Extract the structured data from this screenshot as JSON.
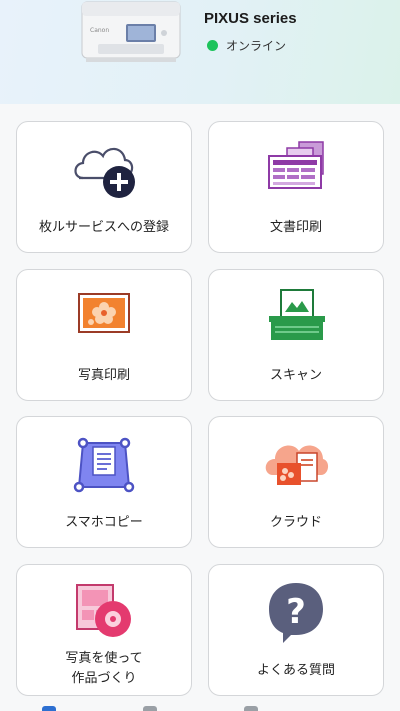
{
  "printer": {
    "name": "PIXUS series",
    "status_text": "オンライン",
    "status_color": "#1cc35b",
    "brand_mark": "Canon"
  },
  "menu": {
    "items": [
      {
        "label": "枚ルサービスへの登録",
        "icon": "cloud-plus-icon"
      },
      {
        "label": "文書印刷",
        "icon": "document-print-icon"
      },
      {
        "label": "写真印刷",
        "icon": "photo-print-icon"
      },
      {
        "label": "スキャン",
        "icon": "scan-icon"
      },
      {
        "label": "スマホコピー",
        "icon": "phone-copy-icon"
      },
      {
        "label": "クラウド",
        "icon": "cloud-icon"
      },
      {
        "label_line1": "写真を使って",
        "label_line2": "作品づくり",
        "icon": "photo-craft-icon"
      },
      {
        "label": "よくある質問",
        "icon": "question-icon"
      }
    ]
  },
  "colors": {
    "accent_purple": "#8e3aa6",
    "accent_orange": "#e8602c",
    "accent_green": "#2a9a4a",
    "accent_indigo": "#5458c7",
    "accent_pink": "#e0457b",
    "question_bg": "#5a5f7d"
  }
}
